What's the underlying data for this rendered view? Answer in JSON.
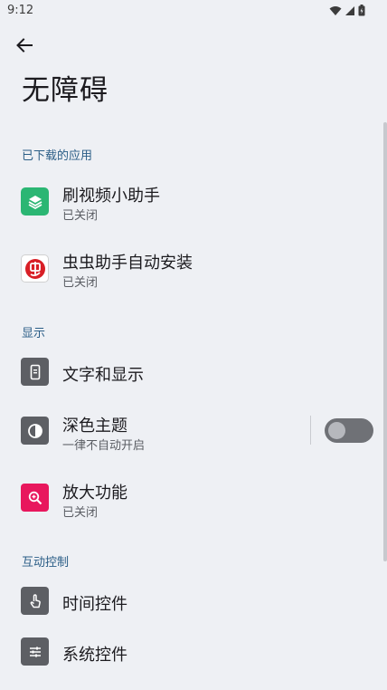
{
  "status_bar": {
    "time": "9:12"
  },
  "page": {
    "title": "无障碍"
  },
  "sections": {
    "downloaded": {
      "header": "已下载的应用",
      "items": [
        {
          "title": "刷视频小助手",
          "subtitle": "已关闭",
          "icon": "stacked-layers-app-icon"
        },
        {
          "title": "虫虫助手自动安装",
          "subtitle": "已关闭",
          "icon": "chongchong-app-icon"
        }
      ]
    },
    "display": {
      "header": "显示",
      "items": [
        {
          "title": "文字和显示",
          "icon": "text-display-icon"
        },
        {
          "title": "深色主题",
          "subtitle": "一律不自动开启",
          "icon": "contrast-icon",
          "toggle_on": false
        },
        {
          "title": "放大功能",
          "subtitle": "已关闭",
          "icon": "magnify-icon"
        }
      ]
    },
    "interaction": {
      "header": "互动控制",
      "items": [
        {
          "title": "时间控件",
          "icon": "touch-hand-icon"
        },
        {
          "title": "系统控件",
          "icon": "sliders-icon"
        }
      ]
    }
  },
  "colors": {
    "background": "#eef0f4",
    "section_header": "#2a5d86",
    "icon_gray": "#5d5f64",
    "icon_pink": "#e8175d",
    "app_green": "#2bb673",
    "app_red": "#d81f26"
  }
}
